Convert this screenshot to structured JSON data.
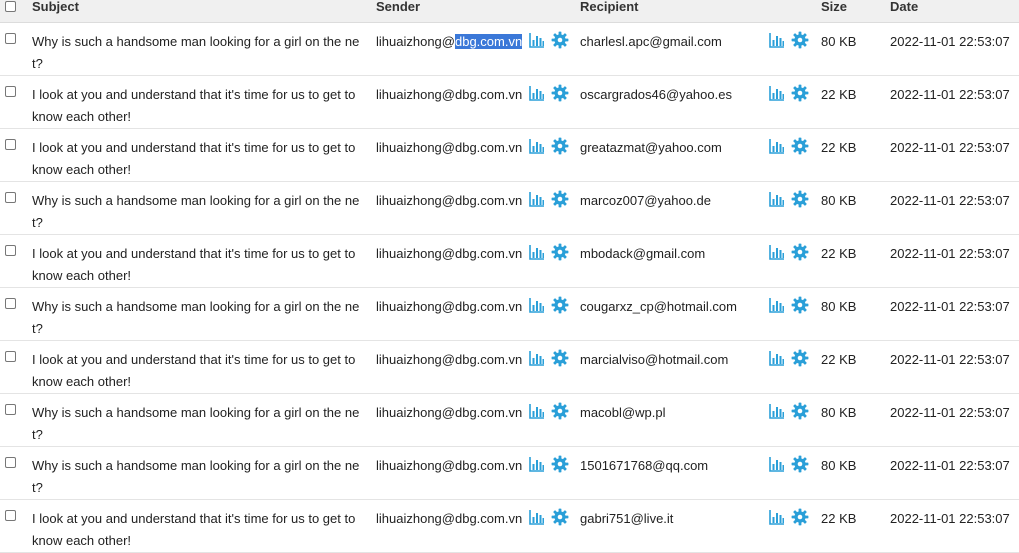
{
  "headers": {
    "subject": "Subject",
    "sender": "Sender",
    "recipient": "Recipient",
    "size": "Size",
    "date": "Date"
  },
  "colors": {
    "icon": "#2a9fd8",
    "selection": "#3b78d8",
    "header_bg": "#f0f0f0"
  },
  "icons": [
    "bar-chart-icon",
    "gear-icon"
  ],
  "rows": [
    {
      "subject": "Why is such a handsome man looking for a girl on the net?",
      "sender_user": "lihuaizhong@",
      "sender_domain": "dbg.com.vn",
      "recipient": "charlesl.apc@gmail.com",
      "size": "80 KB",
      "date": "2022-11-01 22:53:07"
    },
    {
      "subject": "I look at you and understand that it's time for us to get to know each other!",
      "sender_user": "lihuaizhong@",
      "sender_domain": "dbg.com.vn",
      "recipient": "oscargrados46@yahoo.es",
      "size": "22 KB",
      "date": "2022-11-01 22:53:07"
    },
    {
      "subject": "I look at you and understand that it's time for us to get to know each other!",
      "sender_user": "lihuaizhong@",
      "sender_domain": "dbg.com.vn",
      "recipient": "greatazmat@yahoo.com",
      "size": "22 KB",
      "date": "2022-11-01 22:53:07"
    },
    {
      "subject": "Why is such a handsome man looking for a girl on the net?",
      "sender_user": "lihuaizhong@",
      "sender_domain": "dbg.com.vn",
      "recipient": "marcoz007@yahoo.de",
      "size": "80 KB",
      "date": "2022-11-01 22:53:07"
    },
    {
      "subject": "I look at you and understand that it's time for us to get to know each other!",
      "sender_user": "lihuaizhong@",
      "sender_domain": "dbg.com.vn",
      "recipient": "mbodack@gmail.com",
      "size": "22 KB",
      "date": "2022-11-01 22:53:07"
    },
    {
      "subject": "Why is such a handsome man looking for a girl on the net?",
      "sender_user": "lihuaizhong@",
      "sender_domain": "dbg.com.vn",
      "recipient": "cougarxz_cp@hotmail.com",
      "size": "80 KB",
      "date": "2022-11-01 22:53:07"
    },
    {
      "subject": "I look at you and understand that it's time for us to get to know each other!",
      "sender_user": "lihuaizhong@",
      "sender_domain": "dbg.com.vn",
      "recipient": "marcialviso@hotmail.com",
      "size": "22 KB",
      "date": "2022-11-01 22:53:07"
    },
    {
      "subject": "Why is such a handsome man looking for a girl on the net?",
      "sender_user": "lihuaizhong@",
      "sender_domain": "dbg.com.vn",
      "recipient": "macobl@wp.pl",
      "size": "80 KB",
      "date": "2022-11-01 22:53:07"
    },
    {
      "subject": "Why is such a handsome man looking for a girl on the net?",
      "sender_user": "lihuaizhong@",
      "sender_domain": "dbg.com.vn",
      "recipient": "1501671768@qq.com",
      "size": "80 KB",
      "date": "2022-11-01 22:53:07"
    },
    {
      "subject": "I look at you and understand that it's time for us to get to know each other!",
      "sender_user": "lihuaizhong@",
      "sender_domain": "dbg.com.vn",
      "recipient": "gabri751@live.it",
      "size": "22 KB",
      "date": "2022-11-01 22:53:07"
    }
  ]
}
